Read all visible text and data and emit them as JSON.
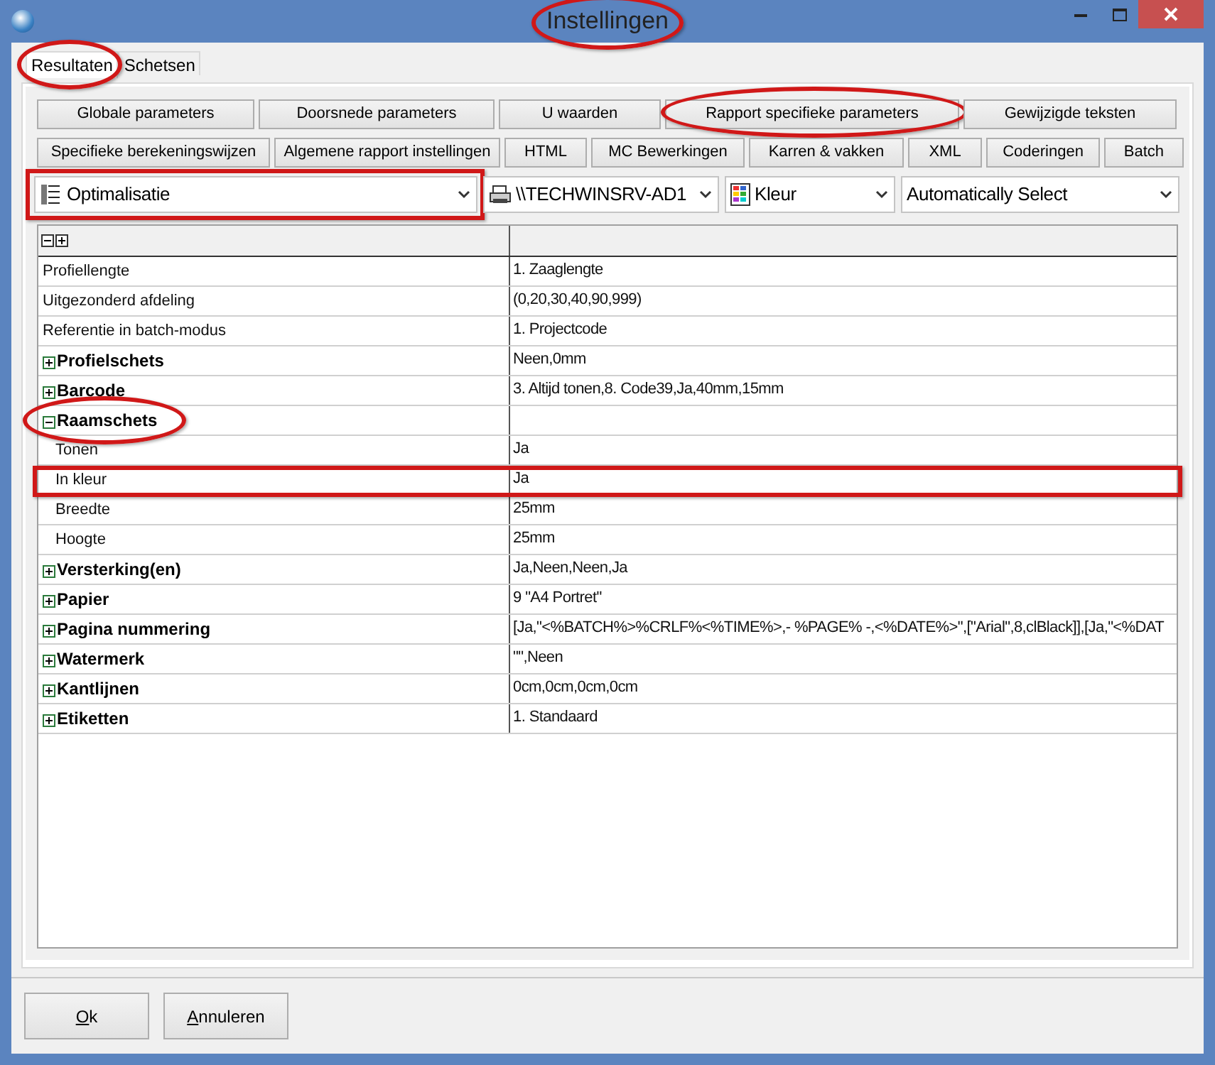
{
  "window": {
    "title": "Instellingen",
    "circled": true
  },
  "tabs": [
    {
      "label": "Resultaten",
      "selected": true,
      "circled": true
    },
    {
      "label": "Schetsen",
      "selected": false,
      "circled": false
    }
  ],
  "button_rows": [
    [
      {
        "label": "Globale parameters",
        "circled": false
      },
      {
        "label": "Doorsnede parameters",
        "circled": false
      },
      {
        "label": "U waarden",
        "circled": false
      },
      {
        "label": "Rapport specifieke parameters",
        "circled": true
      },
      {
        "label": "Gewijzigde teksten",
        "circled": false
      }
    ],
    [
      {
        "label": "Specifieke berekeningswijzen",
        "circled": false
      },
      {
        "label": "Algemene rapport instellingen",
        "circled": false
      },
      {
        "label": "HTML",
        "circled": false
      },
      {
        "label": "MC Bewerkingen",
        "circled": false
      },
      {
        "label": "Karren & vakken",
        "circled": false
      },
      {
        "label": "XML",
        "circled": false
      },
      {
        "label": "Coderingen",
        "circled": false
      },
      {
        "label": "Batch",
        "circled": false
      }
    ]
  ],
  "dropdowns": [
    {
      "kind": "list",
      "value": "Optimalisatie",
      "boxed": true
    },
    {
      "kind": "printer",
      "value": "\\\\TECHWINSRV-AD1",
      "boxed": false
    },
    {
      "kind": "color",
      "value": "Kleur",
      "boxed": false
    },
    {
      "kind": "plain",
      "value": "Automatically Select",
      "boxed": false
    }
  ],
  "grid": {
    "rows": [
      {
        "kind": "property",
        "label": "Profiellengte",
        "value": "1. Zaaglengte",
        "boxed": false
      },
      {
        "kind": "property",
        "label": "Uitgezonderd afdeling",
        "value": "(0,20,30,40,90,999)",
        "boxed": false
      },
      {
        "kind": "property",
        "label": "Referentie in batch-modus",
        "value": "1. Projectcode",
        "boxed": false
      },
      {
        "kind": "category",
        "label": "Profielschets",
        "value": "Neen,0mm",
        "expanded": false,
        "circled": false
      },
      {
        "kind": "category",
        "label": "Barcode",
        "value": "3. Altijd tonen,8. Code39,Ja,40mm,15mm",
        "expanded": false,
        "circled": false
      },
      {
        "kind": "category",
        "label": "Raamschets",
        "expanded": true,
        "circled": true,
        "children": [
          {
            "kind": "property",
            "label": "Tonen",
            "value": "Ja",
            "boxed": false
          },
          {
            "kind": "property",
            "label": "In kleur",
            "value": "Ja",
            "boxed": true
          },
          {
            "kind": "property",
            "label": "Breedte",
            "value": "25mm",
            "boxed": false
          },
          {
            "kind": "property",
            "label": "Hoogte",
            "value": "25mm",
            "boxed": false
          }
        ]
      },
      {
        "kind": "category",
        "label": "Versterking(en)",
        "value": "Ja,Neen,Neen,Ja",
        "expanded": false,
        "circled": false
      },
      {
        "kind": "category",
        "label": "Papier",
        "value": "9 \"A4 Portret\"",
        "expanded": false,
        "circled": false
      },
      {
        "kind": "category",
        "label": "Pagina nummering",
        "value": "[Ja,\"<%BATCH%>%CRLF%<%TIME%>,- %PAGE% -,<%DATE%>\",[\"Arial\",8,clBlack]],[Ja,\"<%DAT",
        "expanded": false,
        "circled": false
      },
      {
        "kind": "category",
        "label": "Watermerk",
        "value": "\"\",Neen",
        "expanded": false,
        "circled": false
      },
      {
        "kind": "category",
        "label": "Kantlijnen",
        "value": "0cm,0cm,0cm,0cm",
        "expanded": false,
        "circled": false
      },
      {
        "kind": "category",
        "label": "Etiketten",
        "value": "1. Standaard",
        "expanded": false,
        "circled": false
      }
    ]
  },
  "footer_buttons": [
    {
      "label": "Ok",
      "mnemonic_underlined": true
    },
    {
      "label": "Annuleren",
      "mnemonic_underlined": true
    }
  ]
}
